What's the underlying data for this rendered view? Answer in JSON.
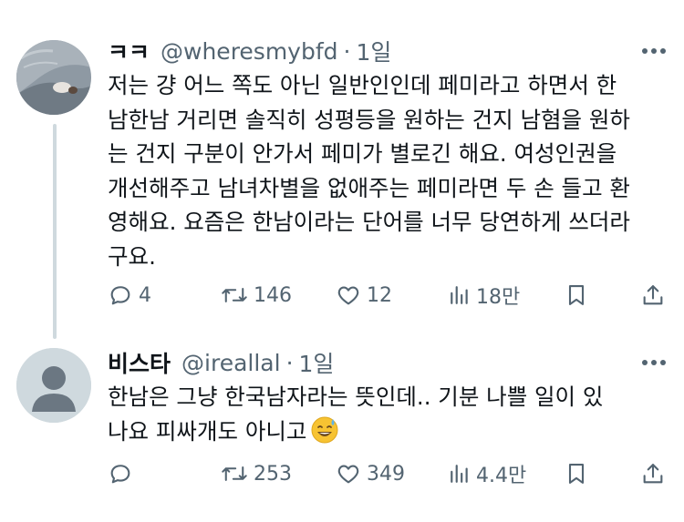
{
  "tweets": [
    {
      "name": "ㅋㅋ",
      "handle": "@wheresmybfd",
      "separator": "·",
      "time": "1일",
      "lines": [
        "저는 걍 어느 쪽도 아닌 일반인인데 페미라고 하면서 한",
        "남한남 거리면 솔직히 성평등을 원하는 건지 남혐을 원하",
        "는 건지 구분이 안가서 페미가 별로긴 해요. 여성인권을",
        "개선해주고 남녀차별을 없애주는 페미라면 두 손 들고 환",
        "영해요. 요즘은 한남이라는 단어를 너무 당연하게 쓰더라",
        "구요."
      ],
      "replies": "4",
      "retweets": "146",
      "likes": "12",
      "views": "18만"
    },
    {
      "name": "비스타",
      "handle": "@ireallal",
      "separator": "·",
      "time": "1일",
      "lines": [
        "한남은 그냥 한국남자라는 뜻인데.. 기분 나쁠 일이 있",
        "나요 피싸개도 아니고"
      ],
      "emoji": "sweat-smile-emoji",
      "replies": "",
      "retweets": "253",
      "likes": "349",
      "views": "4.4만"
    }
  ],
  "icons": {
    "reply": "reply-icon",
    "retweet": "retweet-icon",
    "like": "like-icon",
    "views": "views-icon",
    "bookmark": "bookmark-icon",
    "share": "share-icon",
    "more": "more-icon"
  },
  "colors": {
    "text": "#0f1419",
    "secondary": "#536471",
    "thread_line": "#cfd9de",
    "default_avatar_bg": "#cfd9de"
  }
}
